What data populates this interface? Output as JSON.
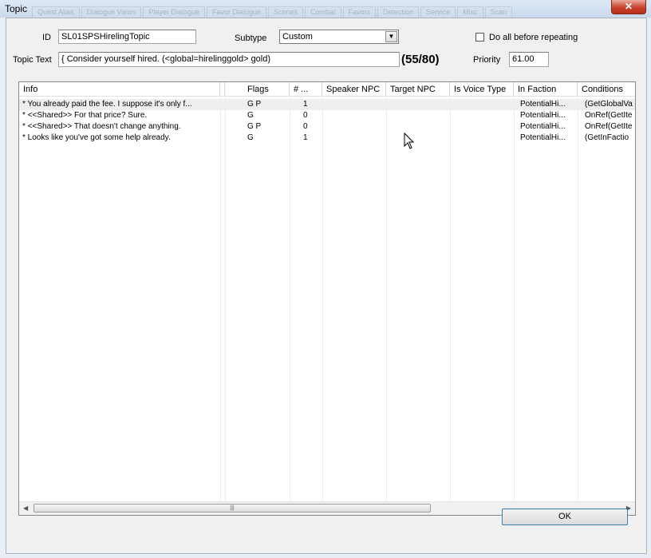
{
  "window": {
    "title": "Topic",
    "close_symbol": "✕"
  },
  "background_tabs": [
    "Quest Alias",
    "Dialogue Views",
    "Player Dialogue",
    "Favor Dialogue",
    "Scenes",
    "Combat",
    "Favors",
    "Detection",
    "Service",
    "Misc",
    "Scan"
  ],
  "form": {
    "id_label": "ID",
    "id_value": "SL01SPSHirelingTopic",
    "subtype_label": "Subtype",
    "subtype_value": "Custom",
    "do_all_label": "Do all before repeating",
    "do_all_checked": false,
    "topic_text_label": "Topic Text",
    "topic_text_value": "{ Consider yourself hired. (<global=hirelinggold> gold)",
    "char_count": "(55/80)",
    "priority_label": "Priority",
    "priority_value": "61.00"
  },
  "table": {
    "headers": [
      "Info",
      "Flags",
      "# ...",
      "Speaker NPC",
      "Target NPC",
      "Is Voice Type",
      "In Faction",
      "Conditions"
    ],
    "rows": [
      {
        "info": "* You already paid the fee. I suppose it's only f...",
        "flags": "G  P",
        "count": "1",
        "speaker": "",
        "target": "",
        "voice": "",
        "faction": "PotentialHi...",
        "conditions": "(GetGlobalVa"
      },
      {
        "info": "* <<Shared>> For that price? Sure.",
        "flags": "G",
        "count": "0",
        "speaker": "",
        "target": "",
        "voice": "",
        "faction": "PotentialHi...",
        "conditions": "OnRef(GetIte"
      },
      {
        "info": "* <<Shared>> That doesn't change anything.",
        "flags": "G  P",
        "count": "0",
        "speaker": "",
        "target": "",
        "voice": "",
        "faction": "PotentialHi...",
        "conditions": "OnRef(GetIte"
      },
      {
        "info": "* Looks like you've got some help already.",
        "flags": "G",
        "count": "1",
        "speaker": "",
        "target": "",
        "voice": "",
        "faction": "PotentialHi...",
        "conditions": "(GetInFactio"
      }
    ],
    "scroll_left": "◀",
    "scroll_right": "▶",
    "thumb_grip": "|||"
  },
  "buttons": {
    "ok": "OK"
  }
}
